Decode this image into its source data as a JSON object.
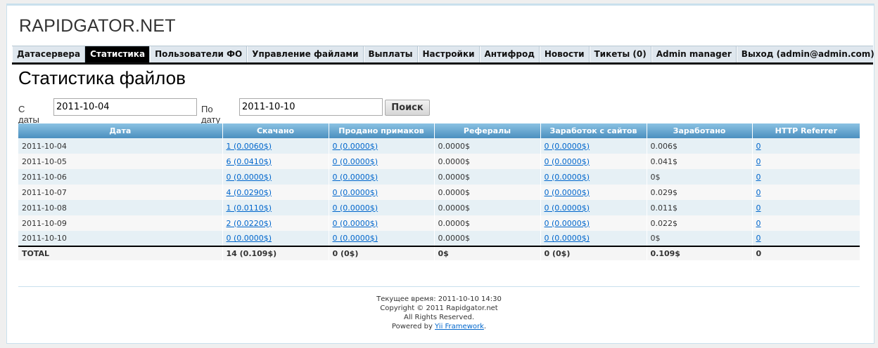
{
  "site": {
    "logo": "RAPIDGATOR.NET"
  },
  "nav": {
    "items": [
      "Датасервера",
      "Статистика",
      "Пользователи ФО",
      "Управление файлами",
      "Выплаты",
      "Настройки",
      "Антифрод",
      "Новости",
      "Тикеты (0)",
      "Admin manager",
      "Выход (admin@admin.com)"
    ],
    "active_index": 1
  },
  "page": {
    "title": "Статистика файлов"
  },
  "filter": {
    "from_label": "С даты",
    "from_value": "2011-10-04",
    "to_label": "По дату",
    "to_value": "2011-10-10",
    "search_label": "Поиск"
  },
  "table": {
    "headers": [
      "Дата",
      "Скачано",
      "Продано примаков",
      "Рефералы",
      "Заработок с сайтов",
      "Заработано",
      "HTTP Referrer"
    ],
    "rows": [
      [
        "2011-10-04",
        "1 (0.0060$)",
        "0 (0.0000$)",
        "0.0000$",
        "0 (0.0000$)",
        "0.006$",
        "0"
      ],
      [
        "2011-10-05",
        "6 (0.0410$)",
        "0 (0.0000$)",
        "0.0000$",
        "0 (0.0000$)",
        "0.041$",
        "0"
      ],
      [
        "2011-10-06",
        "0 (0.0000$)",
        "0 (0.0000$)",
        "0.0000$",
        "0 (0.0000$)",
        "0$",
        "0"
      ],
      [
        "2011-10-07",
        "4 (0.0290$)",
        "0 (0.0000$)",
        "0.0000$",
        "0 (0.0000$)",
        "0.029$",
        "0"
      ],
      [
        "2011-10-08",
        "1 (0.0110$)",
        "0 (0.0000$)",
        "0.0000$",
        "0 (0.0000$)",
        "0.011$",
        "0"
      ],
      [
        "2011-10-09",
        "2 (0.0220$)",
        "0 (0.0000$)",
        "0.0000$",
        "0 (0.0000$)",
        "0.022$",
        "0"
      ],
      [
        "2011-10-10",
        "0 (0.0000$)",
        "0 (0.0000$)",
        "0.0000$",
        "0 (0.0000$)",
        "0$",
        "0"
      ]
    ],
    "link_columns": [
      1,
      2,
      4,
      6
    ],
    "total": [
      "TOTAL",
      "14 (0.109$)",
      "0 (0$)",
      "0$",
      "0 (0$)",
      "0.109$",
      "0"
    ]
  },
  "footer": {
    "time_line": "Текущее время: 2011-10-10 14:30",
    "copyright": "Copyright © 2011 Rapidgator.net",
    "rights": "All Rights Reserved.",
    "powered_prefix": "Powered by ",
    "powered_link": "Yii Framework",
    "powered_suffix": "."
  },
  "colors": {
    "header_gradient_top": "#8ac2e3",
    "header_gradient_bottom": "#4b8fbf",
    "link": "#0066cc",
    "row_odd": "#e6f0f5",
    "row_even": "#f7f7f7",
    "nav_bg": "#dfe7ee"
  }
}
